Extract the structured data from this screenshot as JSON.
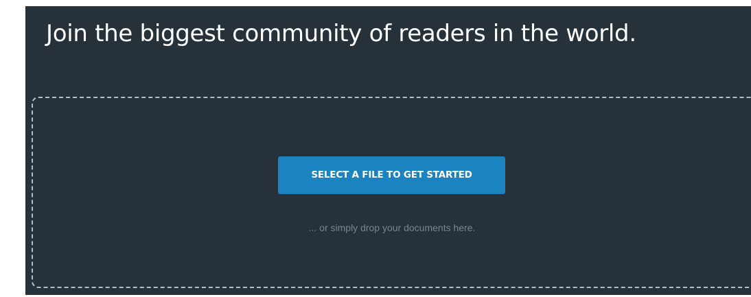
{
  "hero": {
    "headline": "Join the biggest community of readers in the world."
  },
  "upload": {
    "button_label": "SELECT A FILE TO GET STARTED",
    "drop_hint": "... or simply drop your documents here."
  },
  "colors": {
    "panel_background": "#263139",
    "button_background": "#1b83c0",
    "dropzone_border": "#b9bec2",
    "hint_text": "#7b858c"
  }
}
